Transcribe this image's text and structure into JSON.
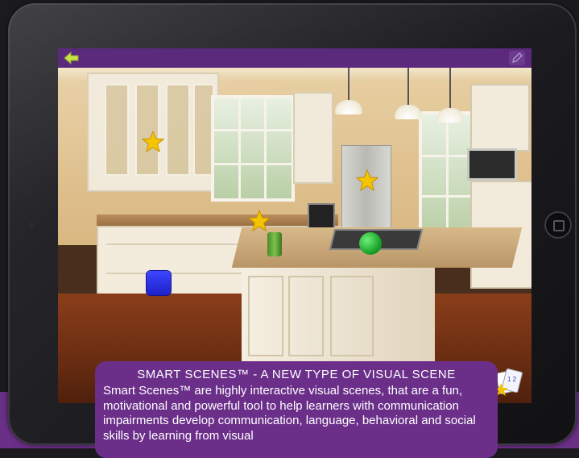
{
  "app": {
    "back_label": "back",
    "edit_label": "edit"
  },
  "scene": {
    "hotspots": [
      {
        "name": "star-upper-cabinet",
        "shape": "star",
        "color": "#f5c400"
      },
      {
        "name": "star-fridge",
        "shape": "star",
        "color": "#f5c400"
      },
      {
        "name": "star-counter",
        "shape": "star",
        "color": "#f5c400"
      },
      {
        "name": "green-circle",
        "shape": "circle",
        "color": "#22b02f"
      },
      {
        "name": "blue-square",
        "shape": "square",
        "color": "#2a30e6"
      }
    ]
  },
  "caption": {
    "title": "SMART SCENES™ - A NEW TYPE OF VISUAL SCENE",
    "body": "Smart Scenes™ are highly interactive visual scenes, that are a fun, motivational and powerful tool to help learners with communication impairments develop communication, language, behavioral and social skills by learning from visual"
  },
  "colors": {
    "app_bar": "#5c2a7c",
    "caption_bg": "#6b2f8a",
    "back_arrow": "#c9e24b",
    "page_purple": "#6a2f86"
  }
}
